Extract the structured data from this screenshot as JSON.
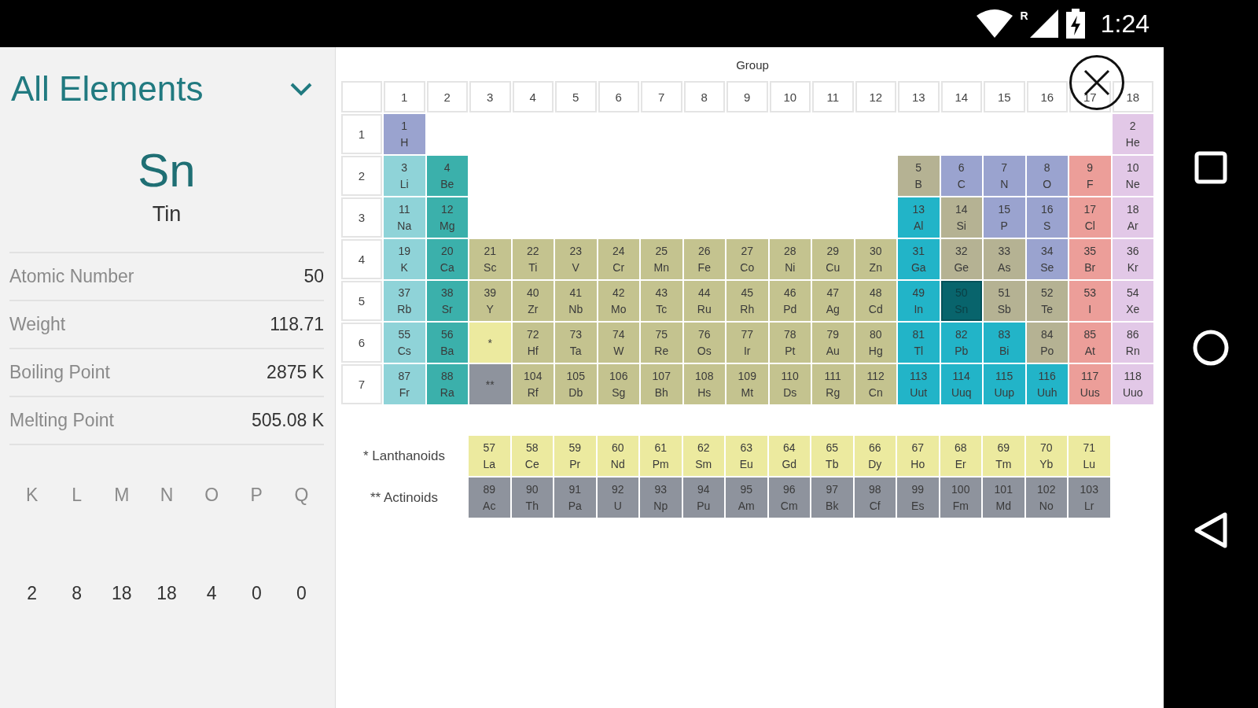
{
  "status_bar": {
    "roaming": "R",
    "time": "1:24"
  },
  "sidebar": {
    "filter": {
      "label": "All Elements",
      "expanded": false
    },
    "element": {
      "symbol": "Sn",
      "name": "Tin"
    },
    "properties": [
      {
        "label": "Atomic Number",
        "value": "50"
      },
      {
        "label": "Weight",
        "value": "118.71"
      },
      {
        "label": "Boiling Point",
        "value": "2875 K"
      },
      {
        "label": "Melting Point",
        "value": "505.08 K"
      }
    ],
    "shells": [
      {
        "label": "K",
        "count": "2"
      },
      {
        "label": "L",
        "count": "8"
      },
      {
        "label": "M",
        "count": "18"
      },
      {
        "label": "N",
        "count": "18"
      },
      {
        "label": "O",
        "count": "4"
      },
      {
        "label": "P",
        "count": "0"
      },
      {
        "label": "Q",
        "count": "0"
      }
    ]
  },
  "table": {
    "title": "Group",
    "groups": [
      "1",
      "2",
      "3",
      "4",
      "5",
      "6",
      "7",
      "8",
      "9",
      "10",
      "11",
      "12",
      "13",
      "14",
      "15",
      "16",
      "17",
      "18"
    ],
    "periods": [
      {
        "label": "1",
        "cells": [
          {
            "kind": "element",
            "number": "1",
            "symbol": "H",
            "color": "#9aa3cf",
            "selected": false
          },
          {
            "kind": "gap"
          },
          {
            "kind": "gap"
          },
          {
            "kind": "gap"
          },
          {
            "kind": "gap"
          },
          {
            "kind": "gap"
          },
          {
            "kind": "gap"
          },
          {
            "kind": "gap"
          },
          {
            "kind": "gap"
          },
          {
            "kind": "gap"
          },
          {
            "kind": "gap"
          },
          {
            "kind": "gap"
          },
          {
            "kind": "gap"
          },
          {
            "kind": "gap"
          },
          {
            "kind": "gap"
          },
          {
            "kind": "gap"
          },
          {
            "kind": "gap"
          },
          {
            "kind": "element",
            "number": "2",
            "symbol": "He",
            "color": "#e2c8e7",
            "selected": false
          }
        ]
      },
      {
        "label": "2",
        "cells": [
          {
            "kind": "element",
            "number": "3",
            "symbol": "Li",
            "color": "#8fd3d8",
            "selected": false
          },
          {
            "kind": "element",
            "number": "4",
            "symbol": "Be",
            "color": "#3bb0ab",
            "selected": false
          },
          {
            "kind": "gap"
          },
          {
            "kind": "gap"
          },
          {
            "kind": "gap"
          },
          {
            "kind": "gap"
          },
          {
            "kind": "gap"
          },
          {
            "kind": "gap"
          },
          {
            "kind": "gap"
          },
          {
            "kind": "gap"
          },
          {
            "kind": "gap"
          },
          {
            "kind": "gap"
          },
          {
            "kind": "element",
            "number": "5",
            "symbol": "B",
            "color": "#b5b293",
            "selected": false
          },
          {
            "kind": "element",
            "number": "6",
            "symbol": "C",
            "color": "#9aa3cf",
            "selected": false
          },
          {
            "kind": "element",
            "number": "7",
            "symbol": "N",
            "color": "#9aa3cf",
            "selected": false
          },
          {
            "kind": "element",
            "number": "8",
            "symbol": "O",
            "color": "#9aa3cf",
            "selected": false
          },
          {
            "kind": "element",
            "number": "9",
            "symbol": "F",
            "color": "#ec9e99",
            "selected": false
          },
          {
            "kind": "element",
            "number": "10",
            "symbol": "Ne",
            "color": "#e2c8e7",
            "selected": false
          }
        ]
      },
      {
        "label": "3",
        "cells": [
          {
            "kind": "element",
            "number": "11",
            "symbol": "Na",
            "color": "#8fd3d8",
            "selected": false
          },
          {
            "kind": "element",
            "number": "12",
            "symbol": "Mg",
            "color": "#3bb0ab",
            "selected": false
          },
          {
            "kind": "gap"
          },
          {
            "kind": "gap"
          },
          {
            "kind": "gap"
          },
          {
            "kind": "gap"
          },
          {
            "kind": "gap"
          },
          {
            "kind": "gap"
          },
          {
            "kind": "gap"
          },
          {
            "kind": "gap"
          },
          {
            "kind": "gap"
          },
          {
            "kind": "gap"
          },
          {
            "kind": "element",
            "number": "13",
            "symbol": "Al",
            "color": "#22b4c8",
            "selected": false
          },
          {
            "kind": "element",
            "number": "14",
            "symbol": "Si",
            "color": "#b5b293",
            "selected": false
          },
          {
            "kind": "element",
            "number": "15",
            "symbol": "P",
            "color": "#9aa3cf",
            "selected": false
          },
          {
            "kind": "element",
            "number": "16",
            "symbol": "S",
            "color": "#9aa3cf",
            "selected": false
          },
          {
            "kind": "element",
            "number": "17",
            "symbol": "Cl",
            "color": "#ec9e99",
            "selected": false
          },
          {
            "kind": "element",
            "number": "18",
            "symbol": "Ar",
            "color": "#e2c8e7",
            "selected": false
          }
        ]
      },
      {
        "label": "4",
        "cells": [
          {
            "kind": "element",
            "number": "19",
            "symbol": "K",
            "color": "#8fd3d8",
            "selected": false
          },
          {
            "kind": "element",
            "number": "20",
            "symbol": "Ca",
            "color": "#3bb0ab",
            "selected": false
          },
          {
            "kind": "element",
            "number": "21",
            "symbol": "Sc",
            "color": "#c4c38f",
            "selected": false
          },
          {
            "kind": "element",
            "number": "22",
            "symbol": "Ti",
            "color": "#c4c38f",
            "selected": false
          },
          {
            "kind": "element",
            "number": "23",
            "symbol": "V",
            "color": "#c4c38f",
            "selected": false
          },
          {
            "kind": "element",
            "number": "24",
            "symbol": "Cr",
            "color": "#c4c38f",
            "selected": false
          },
          {
            "kind": "element",
            "number": "25",
            "symbol": "Mn",
            "color": "#c4c38f",
            "selected": false
          },
          {
            "kind": "element",
            "number": "26",
            "symbol": "Fe",
            "color": "#c4c38f",
            "selected": false
          },
          {
            "kind": "element",
            "number": "27",
            "symbol": "Co",
            "color": "#c4c38f",
            "selected": false
          },
          {
            "kind": "element",
            "number": "28",
            "symbol": "Ni",
            "color": "#c4c38f",
            "selected": false
          },
          {
            "kind": "element",
            "number": "29",
            "symbol": "Cu",
            "color": "#c4c38f",
            "selected": false
          },
          {
            "kind": "element",
            "number": "30",
            "symbol": "Zn",
            "color": "#c4c38f",
            "selected": false
          },
          {
            "kind": "element",
            "number": "31",
            "symbol": "Ga",
            "color": "#22b4c8",
            "selected": false
          },
          {
            "kind": "element",
            "number": "32",
            "symbol": "Ge",
            "color": "#b5b293",
            "selected": false
          },
          {
            "kind": "element",
            "number": "33",
            "symbol": "As",
            "color": "#b5b293",
            "selected": false
          },
          {
            "kind": "element",
            "number": "34",
            "symbol": "Se",
            "color": "#9aa3cf",
            "selected": false
          },
          {
            "kind": "element",
            "number": "35",
            "symbol": "Br",
            "color": "#ec9e99",
            "selected": false
          },
          {
            "kind": "element",
            "number": "36",
            "symbol": "Kr",
            "color": "#e2c8e7",
            "selected": false
          }
        ]
      },
      {
        "label": "5",
        "cells": [
          {
            "kind": "element",
            "number": "37",
            "symbol": "Rb",
            "color": "#8fd3d8",
            "selected": false
          },
          {
            "kind": "element",
            "number": "38",
            "symbol": "Sr",
            "color": "#3bb0ab",
            "selected": false
          },
          {
            "kind": "element",
            "number": "39",
            "symbol": "Y",
            "color": "#c4c38f",
            "selected": false
          },
          {
            "kind": "element",
            "number": "40",
            "symbol": "Zr",
            "color": "#c4c38f",
            "selected": false
          },
          {
            "kind": "element",
            "number": "41",
            "symbol": "Nb",
            "color": "#c4c38f",
            "selected": false
          },
          {
            "kind": "element",
            "number": "42",
            "symbol": "Mo",
            "color": "#c4c38f",
            "selected": false
          },
          {
            "kind": "element",
            "number": "43",
            "symbol": "Tc",
            "color": "#c4c38f",
            "selected": false
          },
          {
            "kind": "element",
            "number": "44",
            "symbol": "Ru",
            "color": "#c4c38f",
            "selected": false
          },
          {
            "kind": "element",
            "number": "45",
            "symbol": "Rh",
            "color": "#c4c38f",
            "selected": false
          },
          {
            "kind": "element",
            "number": "46",
            "symbol": "Pd",
            "color": "#c4c38f",
            "selected": false
          },
          {
            "kind": "element",
            "number": "47",
            "symbol": "Ag",
            "color": "#c4c38f",
            "selected": false
          },
          {
            "kind": "element",
            "number": "48",
            "symbol": "Cd",
            "color": "#c4c38f",
            "selected": false
          },
          {
            "kind": "element",
            "number": "49",
            "symbol": "In",
            "color": "#22b4c8",
            "selected": false
          },
          {
            "kind": "element",
            "number": "50",
            "symbol": "Sn",
            "color": "#08646c",
            "selected": true
          },
          {
            "kind": "element",
            "number": "51",
            "symbol": "Sb",
            "color": "#b5b293",
            "selected": false
          },
          {
            "kind": "element",
            "number": "52",
            "symbol": "Te",
            "color": "#b5b293",
            "selected": false
          },
          {
            "kind": "element",
            "number": "53",
            "symbol": "I",
            "color": "#ec9e99",
            "selected": false
          },
          {
            "kind": "element",
            "number": "54",
            "symbol": "Xe",
            "color": "#e2c8e7",
            "selected": false
          }
        ]
      },
      {
        "label": "6",
        "cells": [
          {
            "kind": "element",
            "number": "55",
            "symbol": "Cs",
            "color": "#8fd3d8",
            "selected": false
          },
          {
            "kind": "element",
            "number": "56",
            "symbol": "Ba",
            "color": "#3bb0ab",
            "selected": false
          },
          {
            "kind": "marker",
            "symbol": "*",
            "color": "#ecea9f"
          },
          {
            "kind": "element",
            "number": "72",
            "symbol": "Hf",
            "color": "#c4c38f",
            "selected": false
          },
          {
            "kind": "element",
            "number": "73",
            "symbol": "Ta",
            "color": "#c4c38f",
            "selected": false
          },
          {
            "kind": "element",
            "number": "74",
            "symbol": "W",
            "color": "#c4c38f",
            "selected": false
          },
          {
            "kind": "element",
            "number": "75",
            "symbol": "Re",
            "color": "#c4c38f",
            "selected": false
          },
          {
            "kind": "element",
            "number": "76",
            "symbol": "Os",
            "color": "#c4c38f",
            "selected": false
          },
          {
            "kind": "element",
            "number": "77",
            "symbol": "Ir",
            "color": "#c4c38f",
            "selected": false
          },
          {
            "kind": "element",
            "number": "78",
            "symbol": "Pt",
            "color": "#c4c38f",
            "selected": false
          },
          {
            "kind": "element",
            "number": "79",
            "symbol": "Au",
            "color": "#c4c38f",
            "selected": false
          },
          {
            "kind": "element",
            "number": "80",
            "symbol": "Hg",
            "color": "#c4c38f",
            "selected": false
          },
          {
            "kind": "element",
            "number": "81",
            "symbol": "Tl",
            "color": "#22b4c8",
            "selected": false
          },
          {
            "kind": "element",
            "number": "82",
            "symbol": "Pb",
            "color": "#22b4c8",
            "selected": false
          },
          {
            "kind": "element",
            "number": "83",
            "symbol": "Bi",
            "color": "#22b4c8",
            "selected": false
          },
          {
            "kind": "element",
            "number": "84",
            "symbol": "Po",
            "color": "#b5b293",
            "selected": false
          },
          {
            "kind": "element",
            "number": "85",
            "symbol": "At",
            "color": "#ec9e99",
            "selected": false
          },
          {
            "kind": "element",
            "number": "86",
            "symbol": "Rn",
            "color": "#e2c8e7",
            "selected": false
          }
        ]
      },
      {
        "label": "7",
        "cells": [
          {
            "kind": "element",
            "number": "87",
            "symbol": "Fr",
            "color": "#8fd3d8",
            "selected": false
          },
          {
            "kind": "element",
            "number": "88",
            "symbol": "Ra",
            "color": "#3bb0ab",
            "selected": false
          },
          {
            "kind": "marker",
            "symbol": "**",
            "color": "#8e939d"
          },
          {
            "kind": "element",
            "number": "104",
            "symbol": "Rf",
            "color": "#c4c38f",
            "selected": false
          },
          {
            "kind": "element",
            "number": "105",
            "symbol": "Db",
            "color": "#c4c38f",
            "selected": false
          },
          {
            "kind": "element",
            "number": "106",
            "symbol": "Sg",
            "color": "#c4c38f",
            "selected": false
          },
          {
            "kind": "element",
            "number": "107",
            "symbol": "Bh",
            "color": "#c4c38f",
            "selected": false
          },
          {
            "kind": "element",
            "number": "108",
            "symbol": "Hs",
            "color": "#c4c38f",
            "selected": false
          },
          {
            "kind": "element",
            "number": "109",
            "symbol": "Mt",
            "color": "#c4c38f",
            "selected": false
          },
          {
            "kind": "element",
            "number": "110",
            "symbol": "Ds",
            "color": "#c4c38f",
            "selected": false
          },
          {
            "kind": "element",
            "number": "111",
            "symbol": "Rg",
            "color": "#c4c38f",
            "selected": false
          },
          {
            "kind": "element",
            "number": "112",
            "symbol": "Cn",
            "color": "#c4c38f",
            "selected": false
          },
          {
            "kind": "element",
            "number": "113",
            "symbol": "Uut",
            "color": "#22b4c8",
            "selected": false
          },
          {
            "kind": "element",
            "number": "114",
            "symbol": "Uuq",
            "color": "#22b4c8",
            "selected": false
          },
          {
            "kind": "element",
            "number": "115",
            "symbol": "Uup",
            "color": "#22b4c8",
            "selected": false
          },
          {
            "kind": "element",
            "number": "116",
            "symbol": "Uuh",
            "color": "#22b4c8",
            "selected": false
          },
          {
            "kind": "element",
            "number": "117",
            "symbol": "Uus",
            "color": "#ec9e99",
            "selected": false
          },
          {
            "kind": "element",
            "number": "118",
            "symbol": "Uuo",
            "color": "#e2c8e7",
            "selected": false
          }
        ]
      }
    ]
  },
  "series": [
    {
      "label": "* Lanthanoids",
      "cells": [
        {
          "number": "57",
          "symbol": "La",
          "color": "#ecea9f",
          "selected": false
        },
        {
          "number": "58",
          "symbol": "Ce",
          "color": "#ecea9f",
          "selected": false
        },
        {
          "number": "59",
          "symbol": "Pr",
          "color": "#ecea9f",
          "selected": false
        },
        {
          "number": "60",
          "symbol": "Nd",
          "color": "#ecea9f",
          "selected": false
        },
        {
          "number": "61",
          "symbol": "Pm",
          "color": "#ecea9f",
          "selected": false
        },
        {
          "number": "62",
          "symbol": "Sm",
          "color": "#ecea9f",
          "selected": false
        },
        {
          "number": "63",
          "symbol": "Eu",
          "color": "#ecea9f",
          "selected": false
        },
        {
          "number": "64",
          "symbol": "Gd",
          "color": "#ecea9f",
          "selected": false
        },
        {
          "number": "65",
          "symbol": "Tb",
          "color": "#ecea9f",
          "selected": false
        },
        {
          "number": "66",
          "symbol": "Dy",
          "color": "#ecea9f",
          "selected": false
        },
        {
          "number": "67",
          "symbol": "Ho",
          "color": "#ecea9f",
          "selected": false
        },
        {
          "number": "68",
          "symbol": "Er",
          "color": "#ecea9f",
          "selected": false
        },
        {
          "number": "69",
          "symbol": "Tm",
          "color": "#ecea9f",
          "selected": false
        },
        {
          "number": "70",
          "symbol": "Yb",
          "color": "#ecea9f",
          "selected": false
        },
        {
          "number": "71",
          "symbol": "Lu",
          "color": "#ecea9f",
          "selected": false
        }
      ]
    },
    {
      "label": "** Actinoids",
      "cells": [
        {
          "number": "89",
          "symbol": "Ac",
          "color": "#8e939d",
          "selected": false
        },
        {
          "number": "90",
          "symbol": "Th",
          "color": "#8e939d",
          "selected": false
        },
        {
          "number": "91",
          "symbol": "Pa",
          "color": "#8e939d",
          "selected": false
        },
        {
          "number": "92",
          "symbol": "U",
          "color": "#8e939d",
          "selected": false
        },
        {
          "number": "93",
          "symbol": "Np",
          "color": "#8e939d",
          "selected": false
        },
        {
          "number": "94",
          "symbol": "Pu",
          "color": "#8e939d",
          "selected": false
        },
        {
          "number": "95",
          "symbol": "Am",
          "color": "#8e939d",
          "selected": false
        },
        {
          "number": "96",
          "symbol": "Cm",
          "color": "#8e939d",
          "selected": false
        },
        {
          "number": "97",
          "symbol": "Bk",
          "color": "#8e939d",
          "selected": false
        },
        {
          "number": "98",
          "symbol": "Cf",
          "color": "#8e939d",
          "selected": false
        },
        {
          "number": "99",
          "symbol": "Es",
          "color": "#8e939d",
          "selected": false
        },
        {
          "number": "100",
          "symbol": "Fm",
          "color": "#8e939d",
          "selected": false
        },
        {
          "number": "101",
          "symbol": "Md",
          "color": "#8e939d",
          "selected": false
        },
        {
          "number": "102",
          "symbol": "No",
          "color": "#8e939d",
          "selected": false
        },
        {
          "number": "103",
          "symbol": "Lr",
          "color": "#8e939d",
          "selected": false
        }
      ]
    }
  ]
}
